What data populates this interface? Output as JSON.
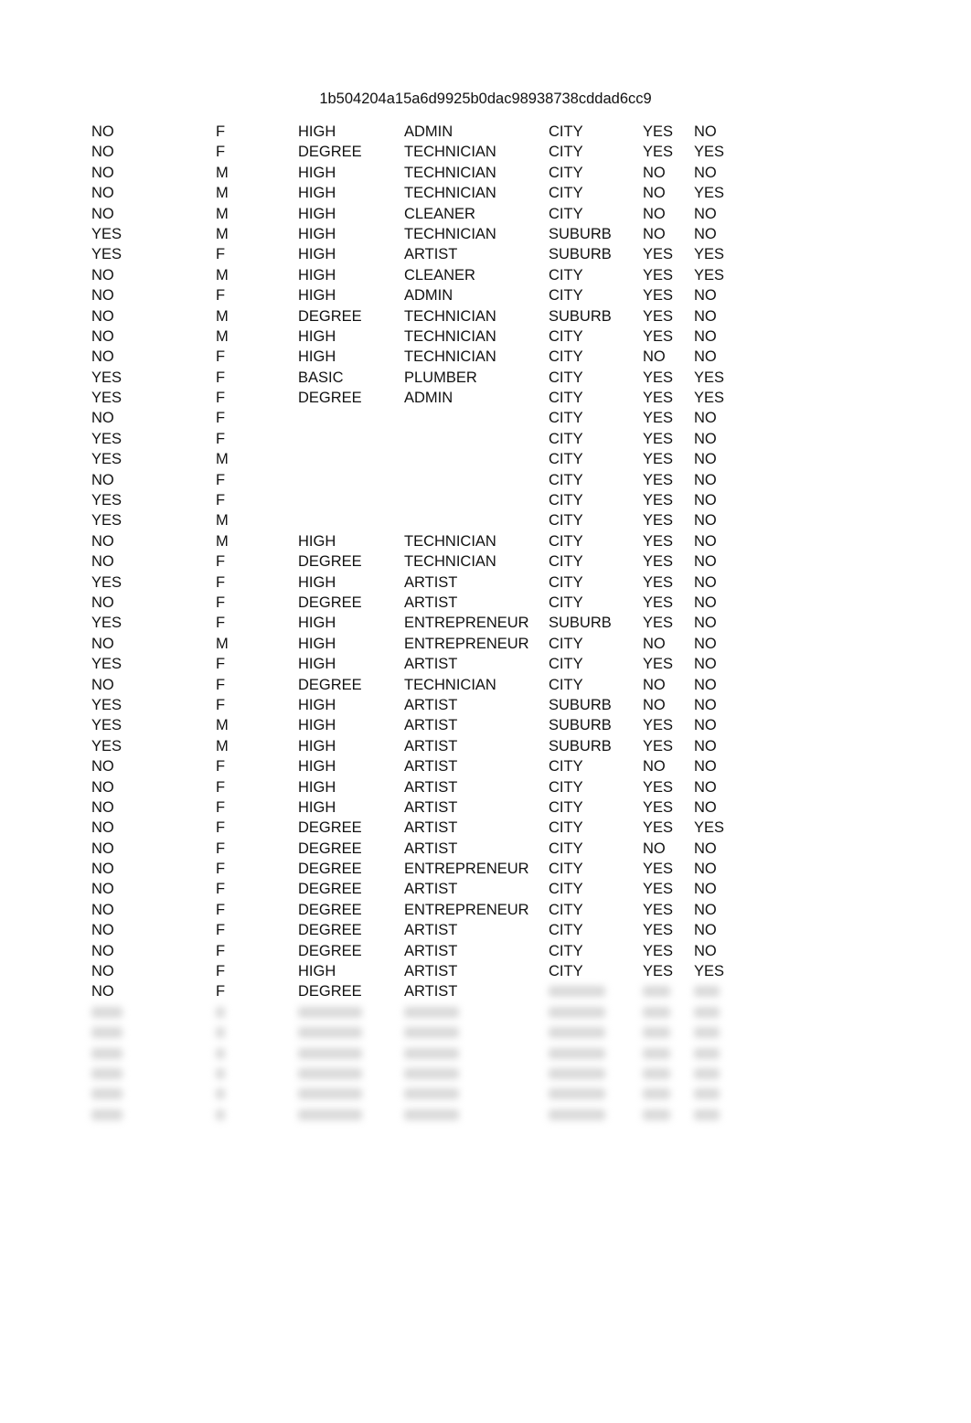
{
  "document": {
    "title": "1b504204a15a6d9925b0dac98938738cddad6cc9"
  },
  "table": {
    "rows": [
      [
        "NO",
        "F",
        "HIGH",
        "ADMIN",
        "CITY",
        "YES",
        "NO"
      ],
      [
        "NO",
        "F",
        "DEGREE",
        "TECHNICIAN",
        "CITY",
        "YES",
        "YES"
      ],
      [
        "NO",
        "M",
        "HIGH",
        "TECHNICIAN",
        "CITY",
        "NO",
        "NO"
      ],
      [
        "NO",
        "M",
        "HIGH",
        "TECHNICIAN",
        "CITY",
        "NO",
        "YES"
      ],
      [
        "NO",
        "M",
        "HIGH",
        "CLEANER",
        "CITY",
        "NO",
        "NO"
      ],
      [
        "YES",
        "M",
        "HIGH",
        "TECHNICIAN",
        "SUBURB",
        "NO",
        "NO"
      ],
      [
        "YES",
        "F",
        "HIGH",
        "ARTIST",
        "SUBURB",
        "YES",
        "YES"
      ],
      [
        "NO",
        "M",
        "HIGH",
        "CLEANER",
        "CITY",
        "YES",
        "YES"
      ],
      [
        "NO",
        "F",
        "HIGH",
        "ADMIN",
        "CITY",
        "YES",
        "NO"
      ],
      [
        "NO",
        "M",
        "DEGREE",
        "TECHNICIAN",
        "SUBURB",
        "YES",
        "NO"
      ],
      [
        "NO",
        "M",
        "HIGH",
        "TECHNICIAN",
        "CITY",
        "YES",
        "NO"
      ],
      [
        "NO",
        "F",
        "HIGH",
        "TECHNICIAN",
        "CITY",
        "NO",
        "NO"
      ],
      [
        "YES",
        "F",
        "BASIC",
        "PLUMBER",
        "CITY",
        "YES",
        "YES"
      ],
      [
        "YES",
        "F",
        "DEGREE",
        "ADMIN",
        "CITY",
        "YES",
        "YES"
      ],
      [
        "NO",
        "F",
        "",
        "",
        "CITY",
        "YES",
        "NO"
      ],
      [
        "YES",
        "F",
        "",
        "",
        "CITY",
        "YES",
        "NO"
      ],
      [
        "YES",
        "M",
        "",
        "",
        "CITY",
        "YES",
        "NO"
      ],
      [
        "NO",
        "F",
        "",
        "",
        "CITY",
        "YES",
        "NO"
      ],
      [
        "YES",
        "F",
        "",
        "",
        "CITY",
        "YES",
        "NO"
      ],
      [
        "YES",
        "M",
        "",
        "",
        "CITY",
        "YES",
        "NO"
      ],
      [
        "NO",
        "M",
        "HIGH",
        "TECHNICIAN",
        "CITY",
        "YES",
        "NO"
      ],
      [
        "NO",
        "F",
        "DEGREE",
        "TECHNICIAN",
        "CITY",
        "YES",
        "NO"
      ],
      [
        "YES",
        "F",
        "HIGH",
        "ARTIST",
        "CITY",
        "YES",
        "NO"
      ],
      [
        "NO",
        "F",
        "DEGREE",
        "ARTIST",
        "CITY",
        "YES",
        "NO"
      ],
      [
        "YES",
        "F",
        "HIGH",
        "ENTREPRENEUR",
        "SUBURB",
        "YES",
        "NO"
      ],
      [
        "NO",
        "M",
        "HIGH",
        "ENTREPRENEUR",
        "CITY",
        "NO",
        "NO"
      ],
      [
        "YES",
        "F",
        "HIGH",
        "ARTIST",
        "CITY",
        "YES",
        "NO"
      ],
      [
        "NO",
        "F",
        "DEGREE",
        "TECHNICIAN",
        "CITY",
        "NO",
        "NO"
      ],
      [
        "YES",
        "F",
        "HIGH",
        "ARTIST",
        "SUBURB",
        "NO",
        "NO"
      ],
      [
        "YES",
        "M",
        "HIGH",
        "ARTIST",
        "SUBURB",
        "YES",
        "NO"
      ],
      [
        "YES",
        "M",
        "HIGH",
        "ARTIST",
        "SUBURB",
        "YES",
        "NO"
      ],
      [
        "NO",
        "F",
        "HIGH",
        "ARTIST",
        "CITY",
        "NO",
        "NO"
      ],
      [
        "NO",
        "F",
        "HIGH",
        "ARTIST",
        "CITY",
        "YES",
        "NO"
      ],
      [
        "NO",
        "F",
        "HIGH",
        "ARTIST",
        "CITY",
        "YES",
        "NO"
      ],
      [
        "NO",
        "F",
        "DEGREE",
        "ARTIST",
        "CITY",
        "YES",
        "YES"
      ],
      [
        "NO",
        "F",
        "DEGREE",
        "ARTIST",
        "CITY",
        "NO",
        "NO"
      ],
      [
        "NO",
        "F",
        "DEGREE",
        "ENTREPRENEUR",
        "CITY",
        "YES",
        "NO"
      ],
      [
        "NO",
        "F",
        "DEGREE",
        "ARTIST",
        "CITY",
        "YES",
        "NO"
      ],
      [
        "NO",
        "F",
        "DEGREE",
        "ENTREPRENEUR",
        "CITY",
        "YES",
        "NO"
      ],
      [
        "NO",
        "F",
        "DEGREE",
        "ARTIST",
        "CITY",
        "YES",
        "NO"
      ],
      [
        "NO",
        "F",
        "DEGREE",
        "ARTIST",
        "CITY",
        "YES",
        "NO"
      ],
      [
        "NO",
        "F",
        "HIGH",
        "ARTIST",
        "CITY",
        "YES",
        "YES"
      ],
      [
        "NO",
        "F",
        "DEGREE",
        "ARTIST",
        null,
        null,
        null
      ]
    ],
    "blurred_row_count": 6
  }
}
